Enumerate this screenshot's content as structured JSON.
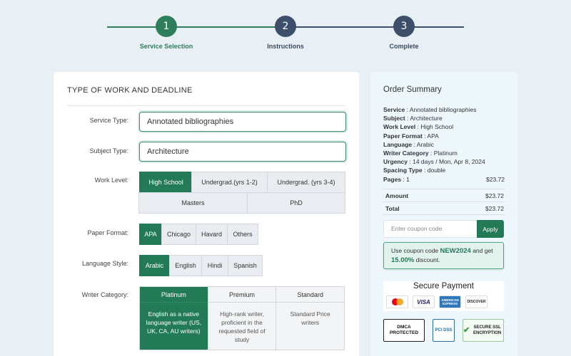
{
  "stepper": {
    "steps": [
      {
        "number": "1",
        "label": "Service Selection"
      },
      {
        "number": "2",
        "label": "Instructions"
      },
      {
        "number": "3",
        "label": "Complete"
      }
    ]
  },
  "form": {
    "title": "TYPE OF WORK AND DEADLINE",
    "service_type": {
      "label": "Service Type:",
      "value": "Annotated bibliographies"
    },
    "subject_type": {
      "label": "Subject Type:",
      "value": "Architecture"
    },
    "work_level": {
      "label": "Work Level:",
      "options": [
        "High School",
        "Undergrad.(yrs 1-2)",
        "Undergrad. (yrs 3-4)",
        "Masters",
        "PhD"
      ],
      "selected": "High School"
    },
    "paper_format": {
      "label": "Paper Format:",
      "options": [
        "APA",
        "Chicago",
        "Havard",
        "Others"
      ],
      "selected": "APA"
    },
    "language_style": {
      "label": "Language Style:",
      "options": [
        "Arabic",
        "English",
        "Hindi",
        "Spanish"
      ],
      "selected": "Arabic"
    },
    "writer_category": {
      "label": "Writer Category:",
      "options": [
        {
          "title": "Platinum",
          "desc": "English as a native language writer (US, UK, CA, AU writers)"
        },
        {
          "title": "Premium",
          "desc": "High-rank writer, proficient in the requested field of study"
        },
        {
          "title": "Standard",
          "desc": "Standard Price writers"
        }
      ],
      "selected": "Platinum"
    }
  },
  "summary": {
    "title": "Order Summary",
    "lines": [
      {
        "key": "Service",
        "value": "Annotated bibliographies"
      },
      {
        "key": "Subject",
        "value": "Architecture"
      },
      {
        "key": "Work Level",
        "value": "High School"
      },
      {
        "key": "Paper Format",
        "value": "APA"
      },
      {
        "key": "Language",
        "value": "Arabic"
      },
      {
        "key": "Writer Category",
        "value": "Platinum"
      },
      {
        "key": "Urgency",
        "value": "14 days / Mon, Apr 8, 2024"
      },
      {
        "key": "Spacing Type",
        "value": "double"
      }
    ],
    "pages": {
      "key": "Pages",
      "value": "1",
      "price": "$23.72"
    },
    "amount": {
      "key": "Amount",
      "value": "$23.72"
    },
    "total": {
      "key": "Total",
      "value": "$23.72"
    },
    "coupon": {
      "placeholder": "Enter coupon code",
      "button": "Apply"
    },
    "promo": {
      "text1": "Use coupon code ",
      "code": "NEW2024",
      "text2": " and get ",
      "discount": "15.00%",
      "text3": " discount."
    },
    "secure_payment": "Secure Payment",
    "cards": [
      "MasterCard",
      "VISA",
      "AMERICAN EXPRESS",
      "DISCOVER"
    ],
    "badges": [
      "DMCA PROTECTED",
      "PCI DSS",
      "SECURE SSL ENCRYPTION"
    ]
  },
  "colors": {
    "accent": "#237a56",
    "step_pending": "#3d4f6b",
    "background": "#e9f0f5",
    "summary_bg": "#eef8fc"
  }
}
